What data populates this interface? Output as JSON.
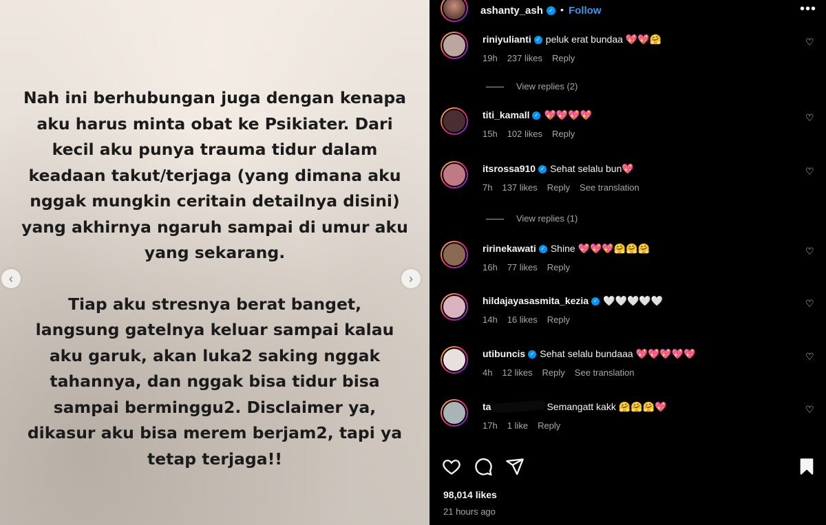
{
  "story": {
    "paragraph1": "Nah ini berhubungan juga dengan kenapa\naku harus minta obat ke Psikiater. Dari\nkecil aku punya trauma tidur dalam\nkeadaan takut/terjaga (yang dimana aku\nnggak mungkin ceritain detailnya disini)\nyang akhirnya ngaruh sampai di umur aku\nyang sekarang.",
    "paragraph2": "Tiap aku stresnya berat banget,\nlangsung gatelnya keluar sampai kalau\naku garuk, akan luka2 saking nggak\ntahannya, dan nggak bisa tidur bisa\nsampai berminggu2. Disclaimer ya,\ndikasur aku bisa merem berjam2, tapi ya\ntetap terjaga!!",
    "prev_icon": "chevron-left-icon",
    "next_icon": "chevron-right-icon"
  },
  "header": {
    "username": "ashanty_ash",
    "dot": "•",
    "follow_label": "Follow",
    "more_icon": "more-icon",
    "more_glyph": "•••"
  },
  "comments": [
    {
      "username": "riniyulianti",
      "text": "peluk erat bundaa 💖💖🤗",
      "time": "19h",
      "likes": "237 likes",
      "reply": "Reply",
      "translation": "",
      "avatar_color": "#b9a7a0"
    },
    {
      "username": "titi_kamall",
      "text": "💖💖💖💖",
      "time": "15h",
      "likes": "102 likes",
      "reply": "Reply",
      "translation": "",
      "avatar_color": "#4a2f32"
    },
    {
      "username": "itsrossa910",
      "text": "Sehat selalu bun💖",
      "time": "7h",
      "likes": "137 likes",
      "reply": "Reply",
      "translation": "See translation",
      "avatar_color": "#c07a86"
    },
    {
      "username": "ririnekawati",
      "text": "Shine 💖💖💖🤗🤗🤗",
      "time": "16h",
      "likes": "77 likes",
      "reply": "Reply",
      "translation": "",
      "avatar_color": "#8a6a52"
    },
    {
      "username": "hildajayasasmita_kezia",
      "text": "🤍🤍🤍🤍🤍",
      "time": "14h",
      "likes": "16 likes",
      "reply": "Reply",
      "translation": "",
      "avatar_color": "#d9b3c0"
    },
    {
      "username": "utibuncis",
      "text": "Sehat selalu bundaaa 💖💖💖💖💖",
      "time": "4h",
      "likes": "12 likes",
      "reply": "Reply",
      "translation": "See translation",
      "avatar_color": "#e8e0dc"
    },
    {
      "username": "ta",
      "text": "Semangatt kakk 🤗🤗🤗💖",
      "time": "17h",
      "likes": "1 like",
      "reply": "Reply",
      "translation": "",
      "avatar_color": "#a9b4b8"
    }
  ],
  "view_replies": [
    {
      "label": "View replies (2)"
    },
    {
      "label": "View replies (1)"
    }
  ],
  "actions": {
    "like_icon": "heart-icon",
    "comment_icon": "comment-icon",
    "share_icon": "share-icon",
    "save_icon": "bookmark-icon"
  },
  "post": {
    "likes": "98,014 likes",
    "time_ago": "21 hours ago"
  },
  "colors": {
    "accent": "#3897f0",
    "verified": "#0095f6",
    "muted": "#a8a8a8"
  }
}
